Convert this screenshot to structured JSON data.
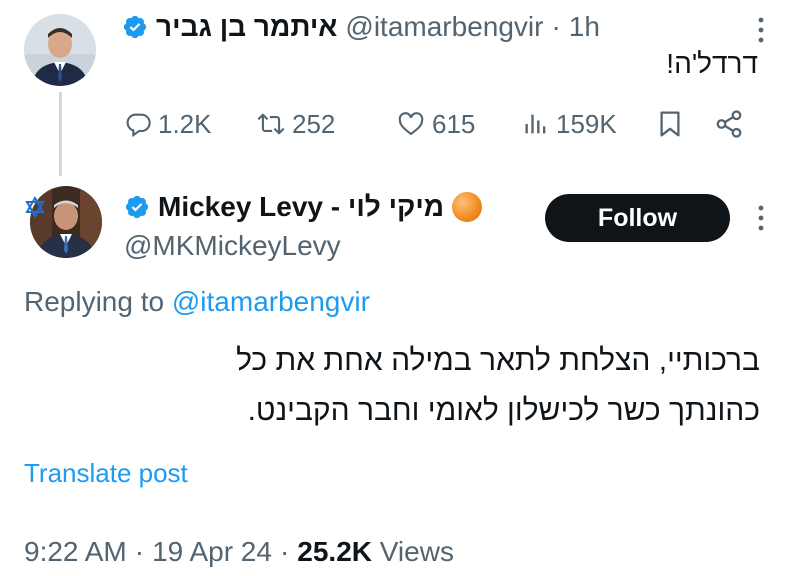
{
  "tweet1": {
    "display_name": "איתמר בן גביר",
    "handle": "@itamarbengvir",
    "separator": "·",
    "time": "1h",
    "text": "דרדל'ה!",
    "actions": {
      "replies": "1.2K",
      "retweets": "252",
      "likes": "615",
      "views": "159K"
    },
    "icons": [
      "verified-badge-icon",
      "more-icon",
      "reply-icon",
      "retweet-icon",
      "like-icon",
      "views-icon",
      "bookmark-icon",
      "share-icon"
    ]
  },
  "tweet2": {
    "display_name": "Mickey Levy - מיקי לוי",
    "handle": "@MKMickeyLevy",
    "follow_label": "Follow",
    "replying_prefix": "Replying to",
    "replying_to": "@itamarbengvir",
    "text_line1": "ברכותיי, הצלחת לתאר במילה אחת את כל",
    "text_line2": "כהונתך כשר לכישלון לאומי וחבר הקבינט.",
    "translate_label": "Translate post",
    "time": "9:22 AM",
    "date": "19 Apr 24",
    "separator": "·",
    "views_count": "25.2K",
    "views_label": "Views"
  },
  "colors": {
    "text": "#0f1419",
    "secondary": "#536471",
    "accent": "#1d9bf0",
    "verified": "#1d9bf0",
    "follow_bg": "#0f1419"
  }
}
